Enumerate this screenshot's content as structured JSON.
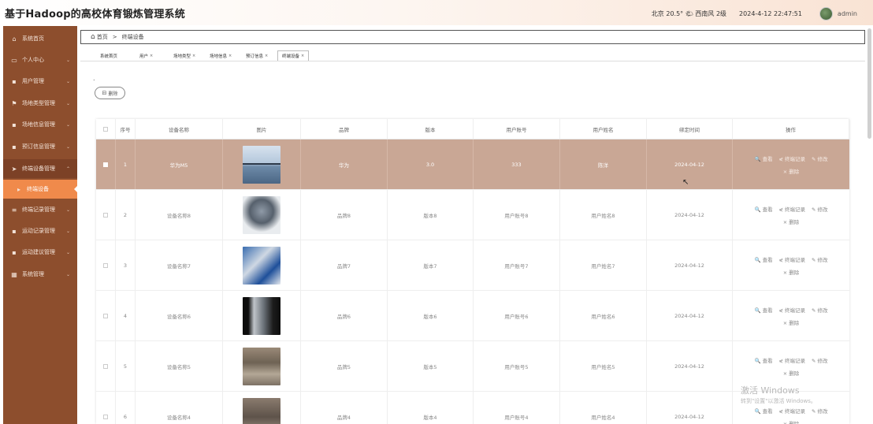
{
  "header": {
    "title": "基于Hadoop的高校体育锻炼管理系统",
    "weather": "北京 20.5° 🌤 西南风 2级",
    "datetime": "2024-4-12 22:47:51",
    "username": "admin"
  },
  "sidebar": {
    "items": [
      {
        "label": "系统首页",
        "icon": "home-icon",
        "glyph": "⌂",
        "chevron": ""
      },
      {
        "label": "个人中心",
        "icon": "user-icon",
        "glyph": "▭",
        "chevron": "⌄"
      },
      {
        "label": "用户管理",
        "icon": "grid-icon",
        "glyph": "▪",
        "chevron": "⌄"
      },
      {
        "label": "场地类型管理",
        "icon": "flag-icon",
        "glyph": "⚑",
        "chevron": "⌄"
      },
      {
        "label": "场地信息管理",
        "icon": "grid-icon",
        "glyph": "▪",
        "chevron": "⌄"
      },
      {
        "label": "预订信息管理",
        "icon": "grid-icon",
        "glyph": "▪",
        "chevron": "⌄"
      },
      {
        "label": "终端设备管理",
        "icon": "send-icon",
        "glyph": "➤",
        "chevron": "⌃"
      },
      {
        "label": "终端设备",
        "icon": "caret-right-icon",
        "glyph": "▸",
        "chevron": ""
      },
      {
        "label": "终端记录管理",
        "icon": "list-icon",
        "glyph": "≡",
        "chevron": "⌄"
      },
      {
        "label": "运动记录管理",
        "icon": "grid-icon",
        "glyph": "▪",
        "chevron": "⌄"
      },
      {
        "label": "运动建议管理",
        "icon": "grid-icon",
        "glyph": "▪",
        "chevron": "⌄"
      },
      {
        "label": "系统管理",
        "icon": "table-icon",
        "glyph": "▦",
        "chevron": "⌄"
      }
    ]
  },
  "breadcrumb": {
    "home": "首页",
    "separator": ">",
    "current": "终端设备"
  },
  "tabs": [
    {
      "label": "系统首页",
      "closable": false
    },
    {
      "label": "用户",
      "closable": true
    },
    {
      "label": "场地类型",
      "closable": true
    },
    {
      "label": "场地信息",
      "closable": true
    },
    {
      "label": "预订信息",
      "closable": true
    },
    {
      "label": "终端设备",
      "closable": true
    }
  ],
  "tab_close_glyph": "×",
  "dot": ".",
  "delete_button": {
    "label": "删除",
    "icon": "trash-icon",
    "glyph": "⊟"
  },
  "table": {
    "headers": [
      "序号",
      "设备名称",
      "图片",
      "品牌",
      "版本",
      "用户账号",
      "用户姓名",
      "绑定时间",
      "操作"
    ],
    "rows": [
      {
        "index": "1",
        "name": "华为M5",
        "image": "bridge-photo",
        "brand": "华为",
        "version": "3.0",
        "account": "333",
        "user": "陈洋",
        "time": "2024-04-12",
        "selected": true
      },
      {
        "index": "2",
        "name": "设备名称8",
        "image": "machine-photo",
        "brand": "品牌8",
        "version": "版本8",
        "account": "用户账号8",
        "user": "用户姓名8",
        "time": "2024-04-12",
        "selected": false
      },
      {
        "index": "3",
        "name": "设备名称7",
        "image": "machine-photo",
        "brand": "品牌7",
        "version": "版本7",
        "account": "用户账号7",
        "user": "用户姓名7",
        "time": "2024-04-12",
        "selected": false
      },
      {
        "index": "4",
        "name": "设备名称6",
        "image": "machine-photo",
        "brand": "品牌6",
        "version": "版本6",
        "account": "用户账号6",
        "user": "用户姓名6",
        "time": "2024-04-12",
        "selected": false
      },
      {
        "index": "5",
        "name": "设备名称5",
        "image": "machine-photo",
        "brand": "品牌5",
        "version": "版本5",
        "account": "用户账号5",
        "user": "用户姓名5",
        "time": "2024-04-12",
        "selected": false
      },
      {
        "index": "6",
        "name": "设备名称4",
        "image": "machine-photo",
        "brand": "品牌4",
        "version": "版本4",
        "account": "用户账号4",
        "user": "用户姓名4",
        "time": "2024-04-12",
        "selected": false
      }
    ],
    "actions": {
      "view": {
        "label": "查看",
        "glyph": "🔍"
      },
      "record": {
        "label": "终端记录",
        "glyph": "⋞"
      },
      "edit": {
        "label": "修改",
        "glyph": "✎"
      },
      "delete": {
        "label": "删除",
        "glyph": "×"
      }
    }
  },
  "watermark": {
    "title": "激活 Windows",
    "subtitle": "转到\"设置\"以激活 Windows。"
  },
  "colors": {
    "sidebar": "#8d4e2d",
    "active_menu": "#f08a4b",
    "selected_row": "#c9a795"
  }
}
